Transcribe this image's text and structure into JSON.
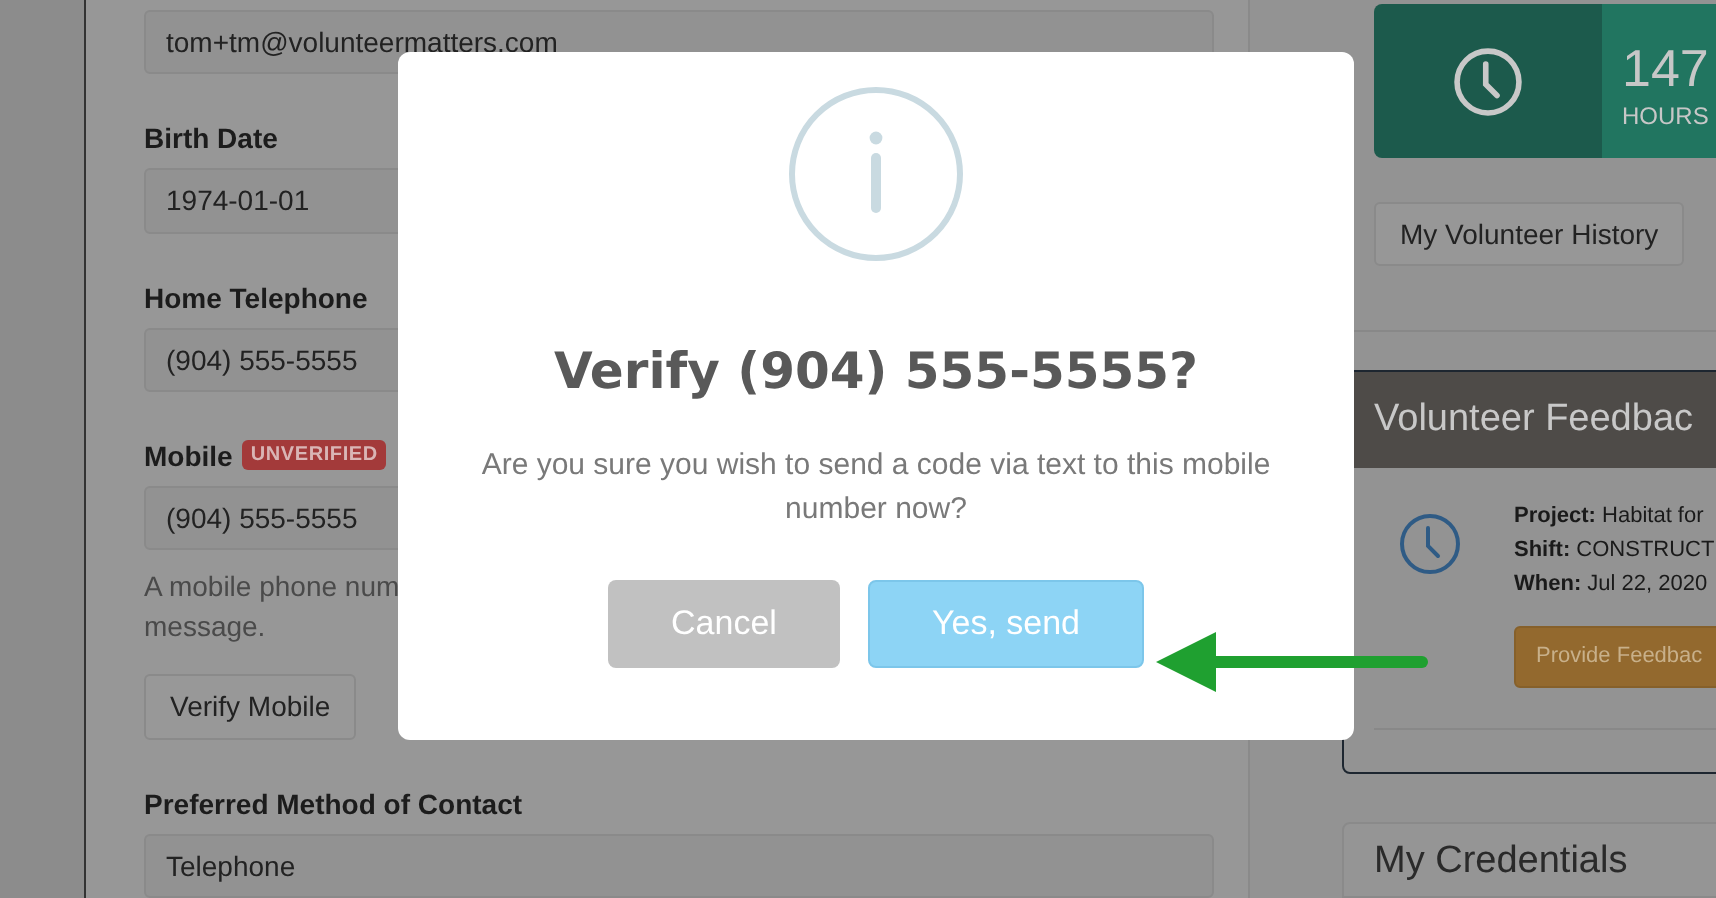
{
  "form": {
    "fields": [
      {
        "value": "tom+tm@volunteermatters.com"
      },
      {
        "label": "Birth Date",
        "value": "1974-01-01"
      },
      {
        "label": "Home Telephone",
        "value": "(904) 555-5555"
      },
      {
        "label": "Mobile",
        "badge": "UNVERIFIED",
        "value": "(904) 555-5555",
        "help": [
          "A mobile phone num",
          "message."
        ],
        "button": "Verify Mobile"
      },
      {
        "label": "Preferred Method of Contact",
        "value": "Telephone"
      }
    ]
  },
  "sidebar": {
    "hours": {
      "value": "147",
      "label": "HOURS"
    },
    "history_button": "My Volunteer History",
    "feedback": {
      "title": "Volunteer Feedbac",
      "lines": [
        "**Project:** Habitat for",
        "**Shift:** CONSTRUCT",
        "**When:** Jul 22, 2020"
      ],
      "button": "Provide Feedbac"
    },
    "credentials": {
      "title": "My Credentials"
    }
  },
  "modal": {
    "title": "Verify (904) 555-5555?",
    "message": "Are you sure you wish to send a code via text to this mobile number now?",
    "buttons": [
      {
        "label": "Cancel",
        "kind": "cancel"
      },
      {
        "label": "Yes, send",
        "kind": "confirm"
      }
    ]
  }
}
